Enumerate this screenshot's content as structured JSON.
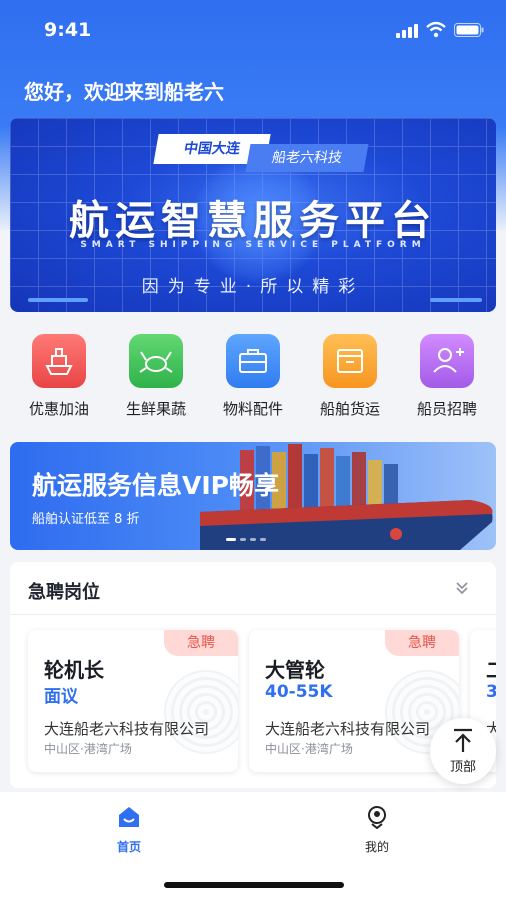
{
  "status": {
    "time": "9:41"
  },
  "greeting": "您好，欢迎来到船老六",
  "banner": {
    "tag_left": "中国大连",
    "tag_right": "船老六科技",
    "title": "航运智慧服务平台",
    "subtitle": "SMART SHIPPING SERVICE PLATFORM",
    "slogan": "因为专业·所以精彩"
  },
  "quick_items": [
    {
      "label": "优惠加油",
      "icon": "ship-fuel-icon",
      "color": "#ef5050"
    },
    {
      "label": "生鲜果蔬",
      "icon": "crab-icon",
      "color": "#3fc25a"
    },
    {
      "label": "物料配件",
      "icon": "toolbox-icon",
      "color": "#3d8ef7"
    },
    {
      "label": "船舶货运",
      "icon": "cargo-box-icon",
      "color": "#f9a330"
    },
    {
      "label": "船员招聘",
      "icon": "add-user-icon",
      "color": "#b36ff0"
    }
  ],
  "promo": {
    "title": "航运服务信息VIP畅享",
    "subtitle": "船舶认证低至 8 折"
  },
  "jobs": {
    "title": "急聘岗位",
    "items": [
      {
        "badge": "急聘",
        "position": "轮机长",
        "salary": "面议",
        "company": "大连船老六科技有限公司",
        "location": "中山区·港湾广场"
      },
      {
        "badge": "急聘",
        "position": "大管轮",
        "salary": "40-55K",
        "company": "大连船老六科技有限公司",
        "location": "中山区·港湾广场"
      }
    ],
    "partial": {
      "position": "二",
      "salary": "3",
      "company": "大"
    }
  },
  "back_to_top": "顶部",
  "tabs": [
    {
      "label": "首页",
      "active": true
    },
    {
      "label": "我的",
      "active": false
    }
  ],
  "colors": {
    "primary": "#2f6ff0",
    "urgent": "#e8534b"
  }
}
